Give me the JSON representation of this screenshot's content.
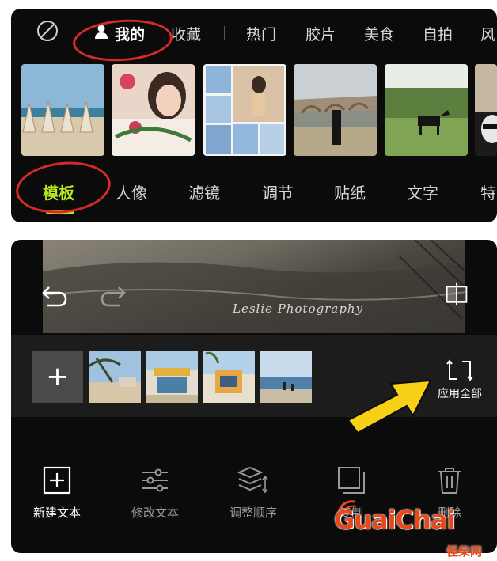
{
  "top_panel": {
    "tabs": [
      "我的",
      "收藏",
      "热门",
      "胶片",
      "美食",
      "自拍",
      "风"
    ],
    "active_tab": "我的",
    "category_tabs": [
      "模板",
      "人像",
      "滤镜",
      "调节",
      "贴纸",
      "文字",
      "特"
    ],
    "active_category": "模板"
  },
  "bottom_panel": {
    "watermark": "Leslie Photography",
    "add_label": "+",
    "apply_all_label": "应用全部",
    "tools": [
      "新建文本",
      "修改文本",
      "调整顺序",
      "复制",
      "删除"
    ]
  },
  "logo": {
    "name": "GuaiChai",
    "sub": "怪柴网"
  },
  "colors": {
    "accent": "#b6e61e",
    "annotation": "#d42a2a",
    "arrow": "#f7d117",
    "logo": "#e8481a"
  }
}
